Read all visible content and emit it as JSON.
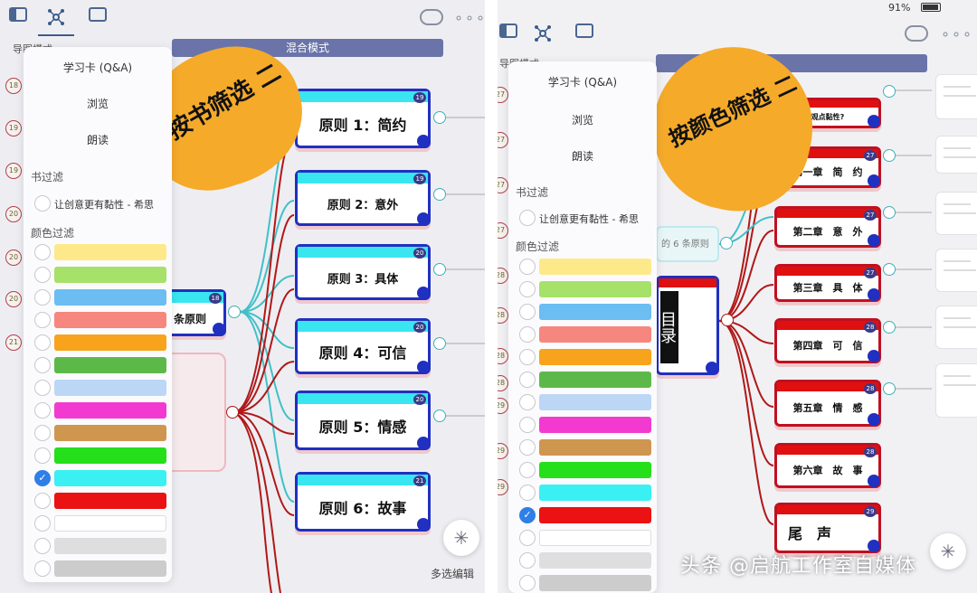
{
  "left": {
    "mode_label": "混合模式",
    "view_tab_partial": "导图模式",
    "menu": {
      "items": [
        "学习卡 (Q&A)",
        "浏览",
        "朗读"
      ],
      "book_filter_heading": "书过滤",
      "book_name": "让创意更有黏性 - 希思",
      "color_filter_heading": "颜色过滤"
    },
    "gutter_numbers": [
      "18",
      "19",
      "19",
      "20",
      "20",
      "20",
      "21"
    ],
    "sticky_text": "按书筛选 二",
    "root_node_text": "条原则",
    "nodes": [
      {
        "text": "原则 1：简约",
        "badge": "19",
        "bar": "#39e6f0"
      },
      {
        "text": "原则 2：意外",
        "badge": "19",
        "bar": "#39e6f0"
      },
      {
        "text": "原则 3：具体",
        "badge": "20",
        "bar": "#39e6f0"
      },
      {
        "text": "原则 4：可信",
        "badge": "20",
        "bar": "#39e6f0"
      },
      {
        "text": "原则 5：情感",
        "badge": "20",
        "bar": "#39e6f0"
      },
      {
        "text": "原则 6：故事",
        "badge": "21",
        "bar": "#39e6f0"
      }
    ],
    "root_badge": "18",
    "multi_edit": "多选编辑",
    "fab_icon": "✳",
    "checked_swatch_index": 10
  },
  "right": {
    "status": "91%",
    "view_tab_partial": "导图模式",
    "menu": {
      "items": [
        "学习卡 (Q&A)",
        "浏览",
        "朗读"
      ],
      "book_filter_heading": "书过滤",
      "book_name": "让创意更有黏性 - 希思",
      "color_filter_heading": "颜色过滤"
    },
    "gutter_numbers": [
      "27",
      "27",
      "27",
      "27",
      "28",
      "28",
      "28",
      "28",
      "29",
      "29",
      "29"
    ],
    "sticky_text": "按颜色筛选 二",
    "toc_text": "目录",
    "partial_label": "的 6 条原则",
    "nodes": [
      {
        "text": "观点黏性?",
        "badge": ""
      },
      {
        "text": "第一章　简　约",
        "badge": "27"
      },
      {
        "text": "第二章　意　外",
        "badge": "27"
      },
      {
        "text": "第三章　具　体",
        "badge": "27"
      },
      {
        "text": "第四章　可　信",
        "badge": "28"
      },
      {
        "text": "第五章　情　感",
        "badge": "28"
      },
      {
        "text": "第六章　故　事",
        "badge": "28"
      },
      {
        "text": "尾　声",
        "badge": "29"
      }
    ],
    "checked_swatch_index": 11
  },
  "swatches_left": [
    "#fde98a",
    "#a6e16a",
    "#6bbdf2",
    "#f6877f",
    "#f8a31c",
    "#5db84a",
    "#bcd6f5",
    "#f33ad0",
    "#cf9650",
    "#24df1a",
    "#3bf0f2",
    "#ea1212",
    "#ffffff",
    "#dedede",
    "#cccccc"
  ],
  "swatches_right": [
    "#fde98a",
    "#a6e16a",
    "#6bbdf2",
    "#f6877f",
    "#f8a31c",
    "#5db84a",
    "#bcd6f5",
    "#f33ad0",
    "#cf9650",
    "#24df1a",
    "#3bf0f2",
    "#ea1212",
    "#ffffff",
    "#dedede",
    "#cccccc"
  ],
  "watermark": "头条 @启航工作室自媒体",
  "colors": {
    "node_border": "#2030c0",
    "sticky": "#f5aa2a",
    "red_bar": "#e01010",
    "cyan_bar": "#39e6f0"
  }
}
